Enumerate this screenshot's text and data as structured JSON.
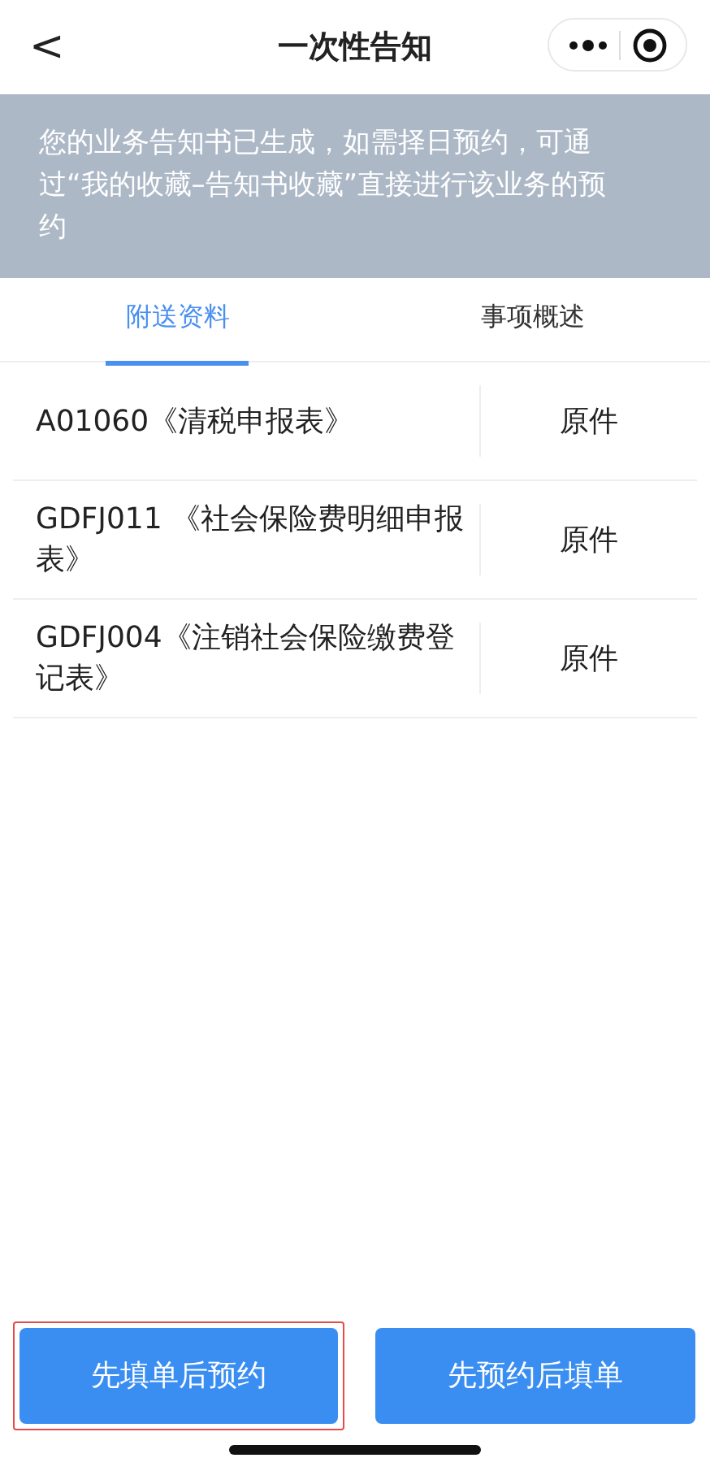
{
  "header": {
    "back": "<",
    "title": "一次性告知"
  },
  "notice": "您的业务告知书已生成，如需择日预约，可通过“我的收藏–告知书收藏”直接进行该业务的预约",
  "tabs": [
    {
      "label": "附送资料",
      "selected": true
    },
    {
      "label": "事项概述",
      "selected": false
    }
  ],
  "materials": [
    {
      "name": "A01060《清税申报表》",
      "type": "原件"
    },
    {
      "name": "GDFJ011 《社会保险费明细申报表》",
      "type": "原件"
    },
    {
      "name": "GDFJ004《注销社会保险缴费登记表》",
      "type": "原件"
    }
  ],
  "buttons": [
    {
      "label": "先填单后预约",
      "highlighted": true
    },
    {
      "label": "先预约后填单",
      "highlighted": false
    }
  ]
}
